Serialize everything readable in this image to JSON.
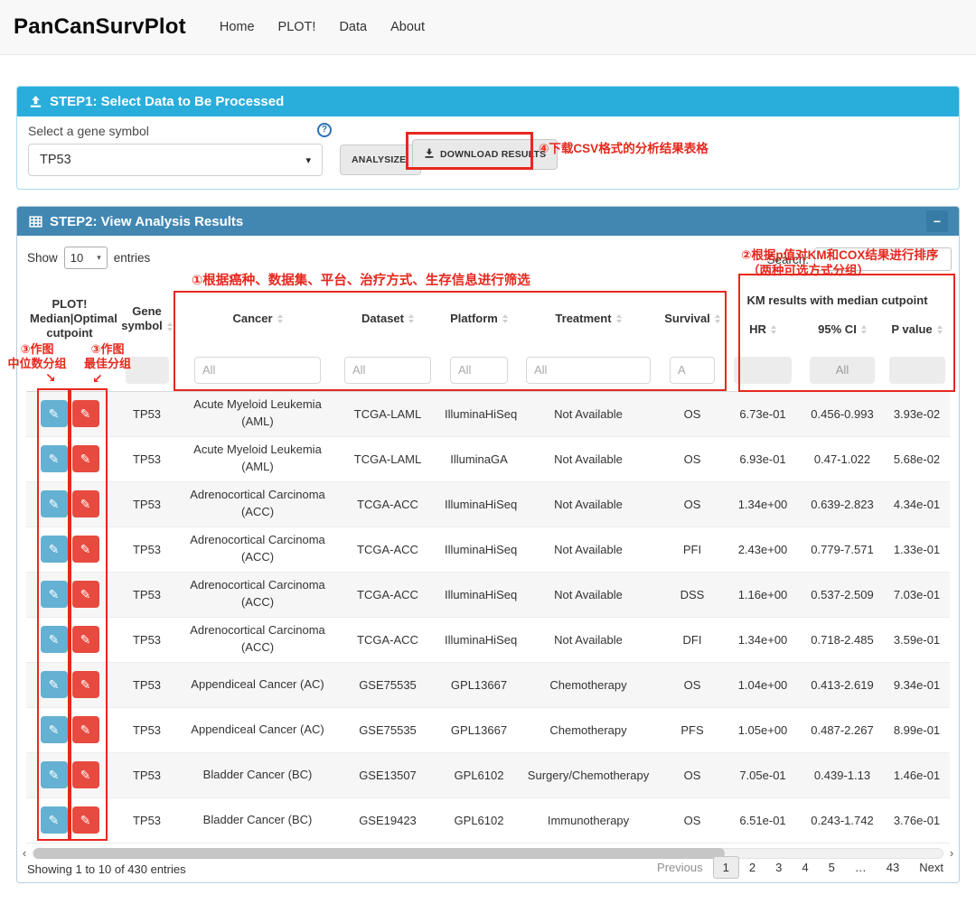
{
  "navbar": {
    "brand": "PanCanSurvPlot",
    "items": [
      {
        "label": "Home"
      },
      {
        "label": "PLOT!"
      },
      {
        "label": "Data"
      },
      {
        "label": "About"
      }
    ]
  },
  "step1": {
    "title": "STEP1: Select Data to Be Processed",
    "gene_label": "Select a gene symbol",
    "gene_value": "TP53",
    "analyze_label": "ANALYSIZE!",
    "download_label": "DOWNLOAD RESULTS"
  },
  "step2": {
    "title": "STEP2: View Analysis Results",
    "show_label": "Show",
    "entries_label": "entries",
    "page_size": "10",
    "search_label": "Search:"
  },
  "table": {
    "plot_header": [
      "PLOT!",
      "Median|Optimal",
      "cutpoint"
    ],
    "headers": {
      "gene": "Gene symbol",
      "cancer": "Cancer",
      "dataset": "Dataset",
      "platform": "Platform",
      "treatment": "Treatment",
      "survival": "Survival",
      "km_group": "KM results with median cutpoint",
      "hr": "HR",
      "ci": "95% CI",
      "p": "P value"
    },
    "filters": {
      "cancer": "All",
      "dataset": "All",
      "platform": "All",
      "treatment": "All",
      "survival": "A",
      "ci": "All"
    },
    "rows": [
      {
        "gene": "TP53",
        "cancer": "Acute Myeloid Leukemia (AML)",
        "dataset": "TCGA-LAML",
        "platform": "IlluminaHiSeq",
        "treatment": "Not Available",
        "survival": "OS",
        "hr": "6.73e-01",
        "ci": "0.456-0.993",
        "p": "3.93e-02"
      },
      {
        "gene": "TP53",
        "cancer": "Acute Myeloid Leukemia (AML)",
        "dataset": "TCGA-LAML",
        "platform": "IlluminaGA",
        "treatment": "Not Available",
        "survival": "OS",
        "hr": "6.93e-01",
        "ci": "0.47-1.022",
        "p": "5.68e-02"
      },
      {
        "gene": "TP53",
        "cancer": "Adrenocortical Carcinoma (ACC)",
        "dataset": "TCGA-ACC",
        "platform": "IlluminaHiSeq",
        "treatment": "Not Available",
        "survival": "OS",
        "hr": "1.34e+00",
        "ci": "0.639-2.823",
        "p": "4.34e-01"
      },
      {
        "gene": "TP53",
        "cancer": "Adrenocortical Carcinoma (ACC)",
        "dataset": "TCGA-ACC",
        "platform": "IlluminaHiSeq",
        "treatment": "Not Available",
        "survival": "PFI",
        "hr": "2.43e+00",
        "ci": "0.779-7.571",
        "p": "1.33e-01"
      },
      {
        "gene": "TP53",
        "cancer": "Adrenocortical Carcinoma (ACC)",
        "dataset": "TCGA-ACC",
        "platform": "IlluminaHiSeq",
        "treatment": "Not Available",
        "survival": "DSS",
        "hr": "1.16e+00",
        "ci": "0.537-2.509",
        "p": "7.03e-01"
      },
      {
        "gene": "TP53",
        "cancer": "Adrenocortical Carcinoma (ACC)",
        "dataset": "TCGA-ACC",
        "platform": "IlluminaHiSeq",
        "treatment": "Not Available",
        "survival": "DFI",
        "hr": "1.34e+00",
        "ci": "0.718-2.485",
        "p": "3.59e-01"
      },
      {
        "gene": "TP53",
        "cancer": "Appendiceal Cancer (AC)",
        "dataset": "GSE75535",
        "platform": "GPL13667",
        "treatment": "Chemotherapy",
        "survival": "OS",
        "hr": "1.04e+00",
        "ci": "0.413-2.619",
        "p": "9.34e-01"
      },
      {
        "gene": "TP53",
        "cancer": "Appendiceal Cancer (AC)",
        "dataset": "GSE75535",
        "platform": "GPL13667",
        "treatment": "Chemotherapy",
        "survival": "PFS",
        "hr": "1.05e+00",
        "ci": "0.487-2.267",
        "p": "8.99e-01"
      },
      {
        "gene": "TP53",
        "cancer": "Bladder Cancer (BC)",
        "dataset": "GSE13507",
        "platform": "GPL6102",
        "treatment": "Surgery/Chemotherapy",
        "survival": "OS",
        "hr": "7.05e-01",
        "ci": "0.439-1.13",
        "p": "1.46e-01"
      },
      {
        "gene": "TP53",
        "cancer": "Bladder Cancer (BC)",
        "dataset": "GSE19423",
        "platform": "GPL6102",
        "treatment": "Immunotherapy",
        "survival": "OS",
        "hr": "6.51e-01",
        "ci": "0.243-1.742",
        "p": "3.76e-01"
      }
    ]
  },
  "footer": {
    "info": "Showing 1 to 10 of 430 entries",
    "previous": "Previous",
    "pages": [
      "1",
      "2",
      "3",
      "4",
      "5",
      "…",
      "43"
    ],
    "active_page": "1",
    "next": "Next"
  },
  "annotations": {
    "a4": "④下载CSV格式的分析结果表格",
    "a1": "①根据癌种、数据集、平台、治疗方式、生存信息进行筛选",
    "a2_line1": "②根据p值对KM和COX结果进行排序",
    "a2_line2": "（两种可选方式分组）",
    "a3_left_1": "③作图",
    "a3_left_2": "中位数分组",
    "a3_right_1": "③作图",
    "a3_right_2": "最佳分组",
    "arrow_left": "↘",
    "arrow_right": "↙"
  },
  "icons": {
    "pencil": "✎",
    "caret_down": "▾",
    "minus": "−",
    "help": "?",
    "scroll_left": "‹",
    "scroll_right": "›"
  },
  "colors": {
    "step1_header": "#29ADDB",
    "step2_header": "#4187B2",
    "annotation_red": "#E6281E",
    "plot_median_button_blue": "#64B1D3",
    "plot_optimal_button_red": "#E74A3F"
  }
}
